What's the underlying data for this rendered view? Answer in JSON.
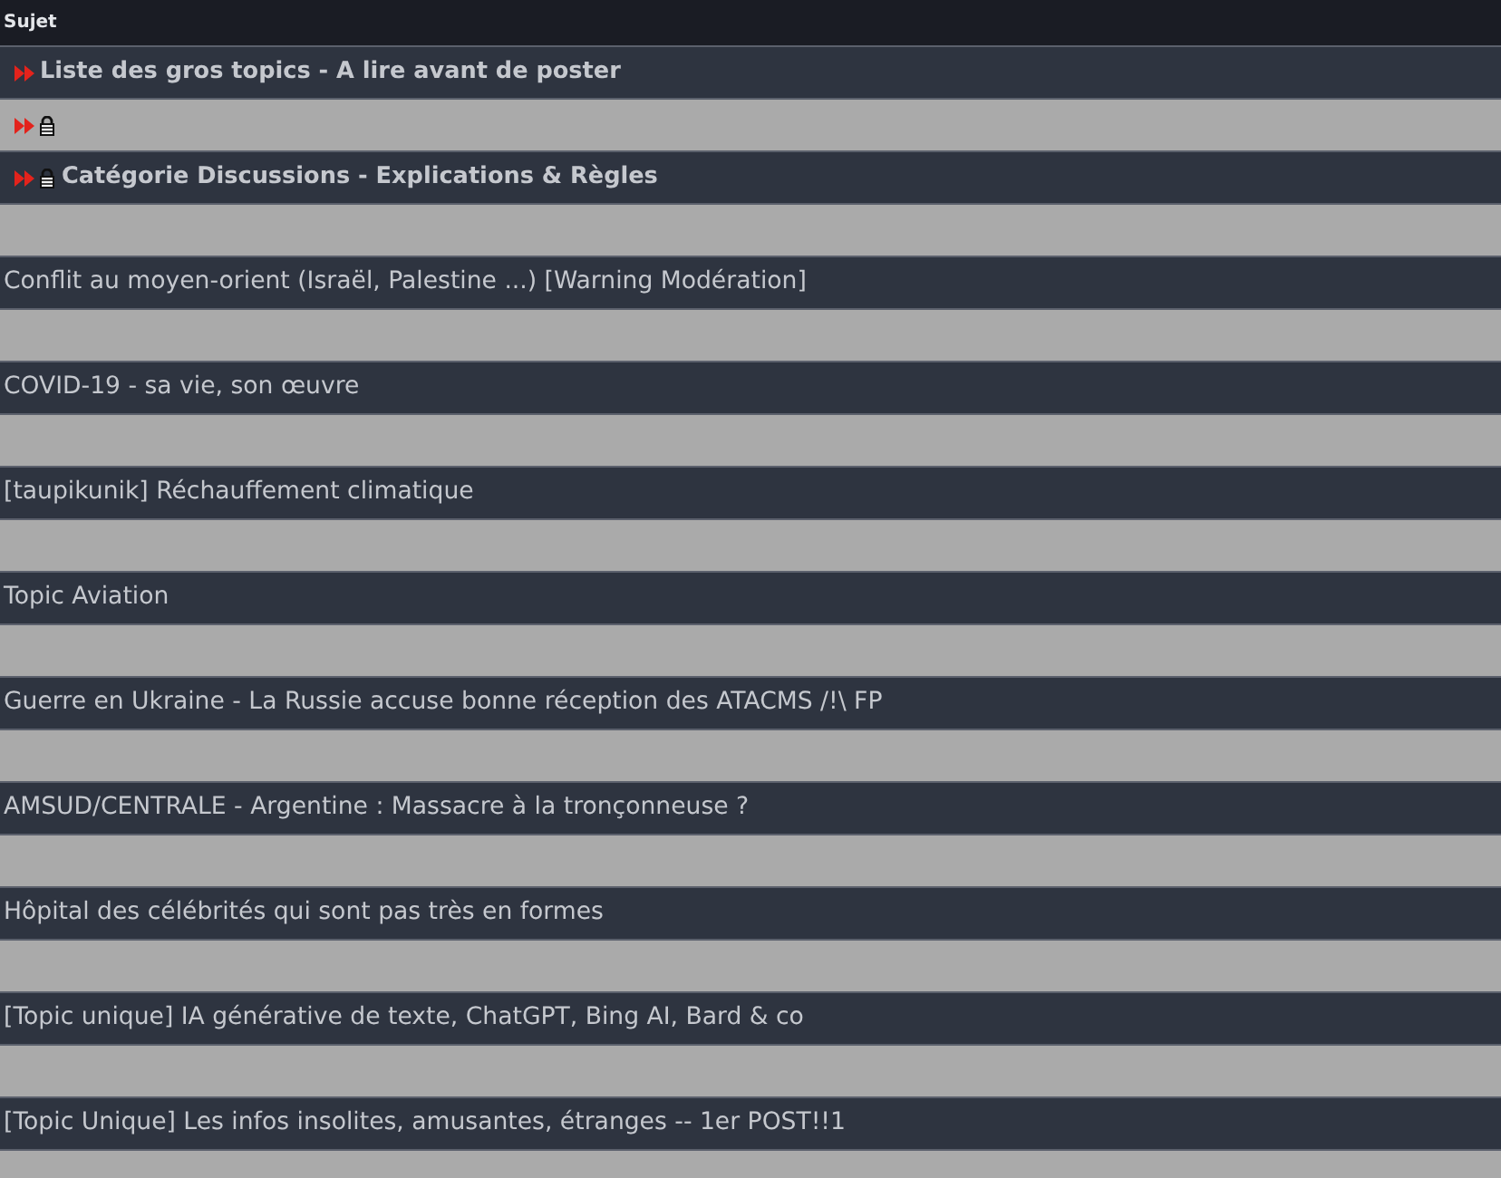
{
  "header": {
    "title": "Sujet"
  },
  "topics": [
    {
      "title": "Liste des gros topics - A lire avant de poster",
      "pinned": true,
      "locked": false
    },
    {
      "pinned": true,
      "locked": true
    },
    {
      "title": "Catégorie Discussions - Explications & Règles",
      "pinned": true,
      "locked": true
    },
    {
      "pinned": false,
      "locked": false
    },
    {
      "title": "Conflit au moyen-orient (Israël, Palestine ...) [Warning Modération]",
      "pinned": false,
      "locked": false
    },
    {
      "pinned": false,
      "locked": false
    },
    {
      "title": "COVID-19 - sa vie, son œuvre",
      "pinned": false,
      "locked": false
    },
    {
      "pinned": false,
      "locked": false
    },
    {
      "title": "[taupikunik] Réchauffement climatique",
      "pinned": false,
      "locked": false
    },
    {
      "pinned": false,
      "locked": false
    },
    {
      "title": "Topic Aviation",
      "pinned": false,
      "locked": false
    },
    {
      "pinned": false,
      "locked": false
    },
    {
      "title": "Guerre en Ukraine - La Russie accuse bonne réception des ATACMS /!\\ FP",
      "pinned": false,
      "locked": false
    },
    {
      "pinned": false,
      "locked": false
    },
    {
      "title": "AMSUD/CENTRALE - Argentine : Massacre à la tronçonneuse ?",
      "pinned": false,
      "locked": false
    },
    {
      "pinned": false,
      "locked": false
    },
    {
      "title": "Hôpital des célébrités qui sont pas très en formes",
      "pinned": false,
      "locked": false
    },
    {
      "pinned": false,
      "locked": false
    },
    {
      "title": "[Topic unique] IA générative de texte, ChatGPT, Bing AI, Bard & co",
      "pinned": false,
      "locked": false
    },
    {
      "pinned": false,
      "locked": false
    },
    {
      "title": "[Topic Unique] Les infos insolites, amusantes, étranges -- 1er POST!!1",
      "pinned": false,
      "locked": false
    },
    {
      "pinned": false,
      "locked": false
    }
  ]
}
